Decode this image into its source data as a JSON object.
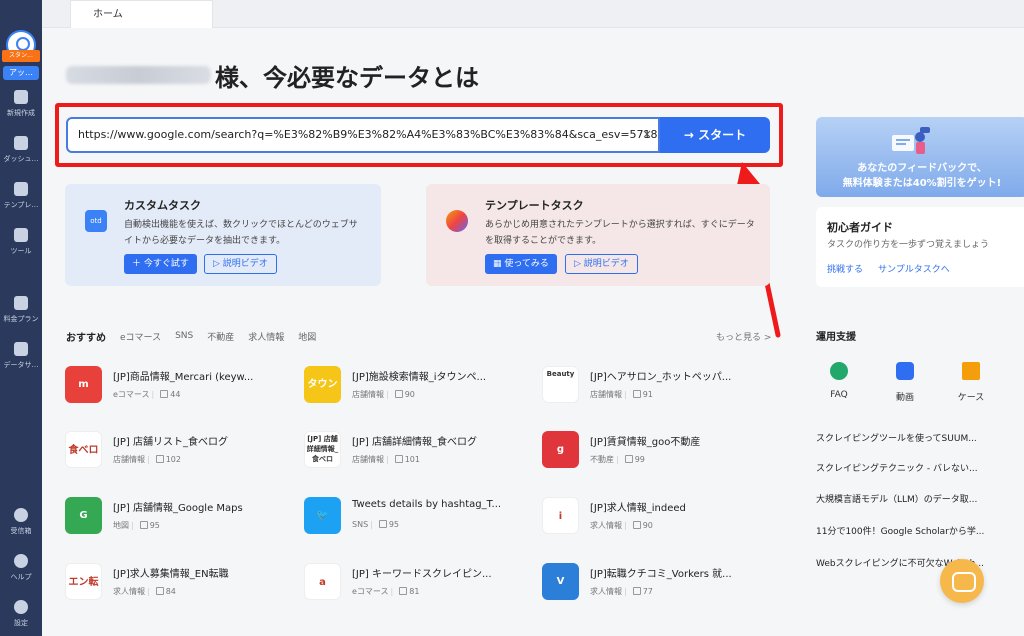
{
  "sidebar": {
    "plan_badge": "スタン…",
    "app_badge": "アッ…",
    "items": [
      {
        "label": "新規作成",
        "icon": "plus-square-icon"
      },
      {
        "label": "ダッシュ…",
        "icon": "flag-icon"
      },
      {
        "label": "テンプレ…",
        "icon": "template-icon"
      },
      {
        "label": "ツール",
        "icon": "toolbox-icon"
      },
      {
        "label": "料金プラン",
        "icon": "crown-icon"
      },
      {
        "label": "データサ…",
        "icon": "diamond-check-icon"
      },
      {
        "label": "受信箱",
        "icon": "bell-icon"
      },
      {
        "label": "ヘルプ",
        "icon": "help-icon"
      },
      {
        "label": "設定",
        "icon": "gear-icon"
      }
    ]
  },
  "tabs": [
    {
      "label": "ホーム"
    }
  ],
  "heading": {
    "text": "様、今必要なデータとは"
  },
  "url_input": {
    "value": "https://www.google.com/search?q=%E3%82%B9%E3%82%A4%E3%83%BC%E3%83%84&sca_esv=5718"
  },
  "start_button": {
    "label": "スタート"
  },
  "cards": {
    "custom": {
      "icon_text": "otd",
      "title": "カスタムタスク",
      "desc": "自動検出機能を使えば、数クリックでほとんどのウェブサイトから必要なデータを抽出できます。",
      "primary": "今すぐ試す",
      "secondary": "説明ビデオ"
    },
    "template": {
      "title": "テンプレートタスク",
      "desc": "あらかじめ用意されたテンプレートから選択すれば、すぐにデータを取得することができます。",
      "primary": "使ってみる",
      "secondary": "説明ビデオ"
    }
  },
  "promo": {
    "line1": "あなたのフィードバックで、",
    "line2": "無料体験または40%割引をゲット!"
  },
  "guide": {
    "title": "初心者ガイド",
    "subtitle": "タスクの作り方を一歩ずつ覚えましょう",
    "link1": "挑戦する",
    "link2": "サンプルタスクへ"
  },
  "recommend": {
    "tabs": [
      "おすすめ",
      "eコマース",
      "SNS",
      "不動産",
      "求人情報",
      "地図"
    ],
    "more": "もっと見る >",
    "templates": [
      {
        "title": "[JP]商品情報_Mercari (keyw...",
        "category": "eコマース",
        "likes": "44",
        "icon_text": "m",
        "color": "#e8413c"
      },
      {
        "title": "[JP]施設検索情報_iタウンペ...",
        "category": "店舗情報",
        "likes": "90",
        "icon_text": "タウン",
        "color": "#f5c518"
      },
      {
        "title": "[JP]ヘアサロン_ホットペッパ...",
        "category": "店舗情報",
        "likes": "91",
        "icon_text": "Beauty",
        "color": "#ffffff"
      },
      {
        "title": "[JP] 店舗リスト_食べログ",
        "category": "店舗情報",
        "likes": "102",
        "icon_text": "食べログ",
        "color": "#ffffff"
      },
      {
        "title": "[JP] 店舗詳細情報_食べログ",
        "category": "店舗情報",
        "likes": "101",
        "icon_text": "[JP] 店舗詳細情報_食べロ",
        "color": "#ffffff"
      },
      {
        "title": "[JP]賃貸情報_goo不動産",
        "category": "不動産",
        "likes": "99",
        "icon_text": "g",
        "color": "#e0353b"
      },
      {
        "title": "[JP] 店舗情報_Google Maps",
        "category": "地図",
        "likes": "95",
        "icon_text": "G",
        "color": "#34a853"
      },
      {
        "title": "Tweets details by hashtag_T...",
        "category": "SNS",
        "likes": "95",
        "icon_text": "🐦",
        "color": "#1da1f2"
      },
      {
        "title": "[JP]求人情報_indeed",
        "category": "求人情報",
        "likes": "90",
        "icon_text": "i",
        "color": "#ffffff"
      },
      {
        "title": "[JP]求人募集情報_EN転職",
        "category": "求人情報",
        "likes": "84",
        "icon_text": "エン転職",
        "color": "#ffffff"
      },
      {
        "title": "[JP] キーワードスクレイピン...",
        "category": "eコマース",
        "likes": "81",
        "icon_text": "a",
        "color": "#ffffff"
      },
      {
        "title": "[JP]転職クチコミ_Vorkers 就...",
        "category": "求人情報",
        "likes": "77",
        "icon_text": "V",
        "color": "#2b7fd8"
      }
    ]
  },
  "support": {
    "title": "運用支援",
    "items": [
      {
        "label": "FAQ",
        "icon": "faq-icon",
        "color": "#22a86b"
      },
      {
        "label": "動画",
        "icon": "video-icon",
        "color": "#2f6ef0"
      },
      {
        "label": "ケース",
        "icon": "case-icon",
        "color": "#f59e0b"
      }
    ],
    "links": [
      "スクレイピングツールを使ってSUUM...",
      "スクレイピングテクニック - バレない...",
      "大規模言語モデル（LLM）のデータ取...",
      "11分で100件！Google Scholarから学...",
      "Webスクレイピングに不可欠なWeb th..."
    ]
  },
  "colors": {
    "accent": "#2f6ef0",
    "highlight": "#ef1a1a",
    "sidebar": "#2b3a5c"
  }
}
